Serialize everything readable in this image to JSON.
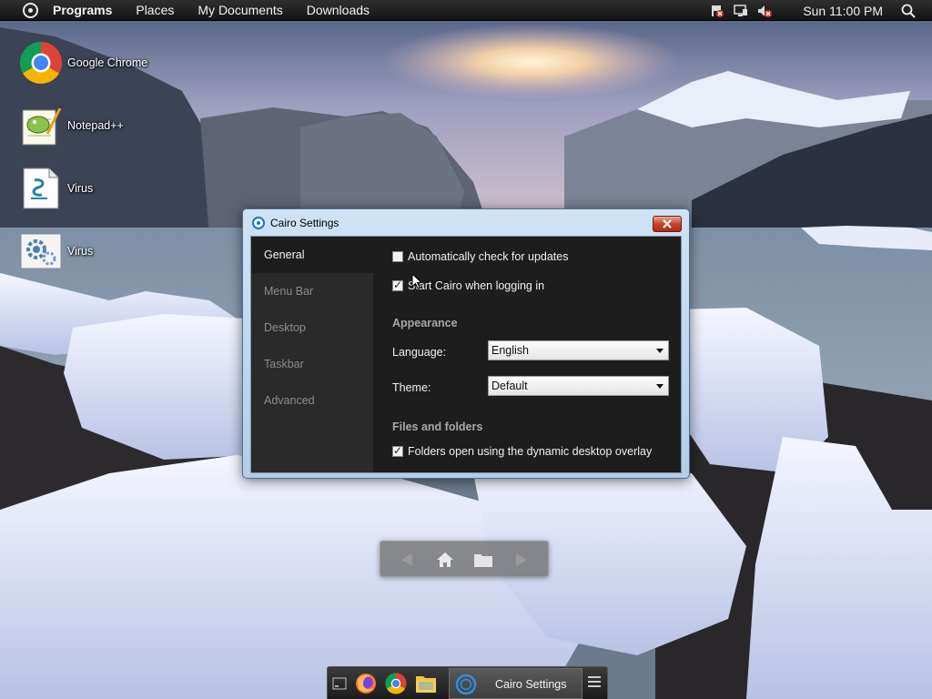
{
  "menubar": {
    "items": [
      "Programs",
      "Places",
      "My Documents",
      "Downloads"
    ],
    "tray_icons": [
      "network-error-icon",
      "monitor-icon",
      "volume-muted-icon"
    ],
    "clock": "Sun 11:00 PM"
  },
  "desktop": {
    "icons": [
      {
        "label": "Google Chrome",
        "icon": "chrome-icon"
      },
      {
        "label": "Notepad++",
        "icon": "notepadpp-icon"
      },
      {
        "label": "Virus",
        "icon": "script-file-icon"
      },
      {
        "label": "Virus",
        "icon": "settings-file-icon"
      }
    ]
  },
  "window": {
    "title": "Cairo Settings",
    "sidebar": {
      "items": [
        "General",
        "Menu Bar",
        "Desktop",
        "Taskbar",
        "Advanced"
      ],
      "active": "General"
    },
    "general": {
      "auto_update": {
        "label": "Automatically check for updates",
        "checked": false
      },
      "start_login": {
        "label": "Start Cairo when logging in",
        "checked": true
      },
      "appearance_title": "Appearance",
      "language_label": "Language:",
      "language_value": "English",
      "theme_label": "Theme:",
      "theme_value": "Default",
      "files_title": "Files and folders",
      "dynamic_overlay": {
        "label": "Folders open using the dynamic desktop overlay",
        "checked": true
      }
    }
  },
  "taskbar": {
    "pinned": [
      "desktop-icon",
      "firefox-icon",
      "chrome-icon",
      "file-explorer-icon"
    ],
    "active_task": "Cairo Settings"
  },
  "colors": {
    "menubar": "#1e1e1e",
    "window_client": "#1d1d1d",
    "sidebar": "#2a2a2a",
    "close_button": "#c7442b"
  }
}
